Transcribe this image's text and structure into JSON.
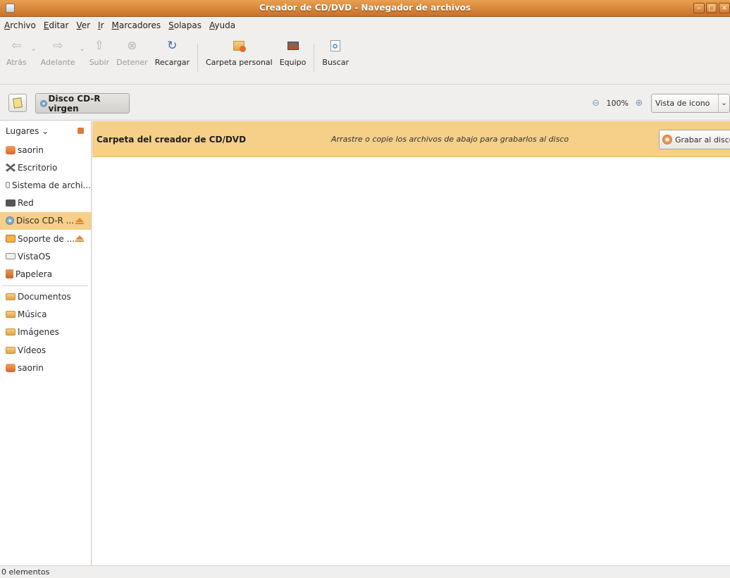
{
  "window": {
    "title": "Creador de CD/DVD - Navegador de archivos"
  },
  "menubar": {
    "items": [
      "Archivo",
      "Editar",
      "Ver",
      "Ir",
      "Marcadores",
      "Solapas",
      "Ayuda"
    ]
  },
  "toolbar": {
    "back": "Atrás",
    "forward": "Adelante",
    "up": "Subir",
    "stop": "Detener",
    "reload": "Recargar",
    "home": "Carpeta personal",
    "computer": "Equipo",
    "search": "Buscar"
  },
  "location": {
    "path_button": "Disco CD-R virgen",
    "zoom": "100%",
    "view_mode": "Vista de icono"
  },
  "sidebar": {
    "header": "Lugares",
    "places": [
      {
        "label": "saorin",
        "icon": "home-folder-icon"
      },
      {
        "label": "Escritorio",
        "icon": "desktop-icon"
      },
      {
        "label": "Sistema de archi...",
        "icon": "drive-icon"
      },
      {
        "label": "Red",
        "icon": "network-icon"
      },
      {
        "label": "Disco CD-R ...",
        "icon": "cd-icon",
        "selected": true
      },
      {
        "label": "Soporte de ...",
        "icon": "media-icon"
      },
      {
        "label": "VistaOS",
        "icon": "drive-icon"
      },
      {
        "label": "Papelera",
        "icon": "trash-icon"
      }
    ],
    "bookmarks": [
      {
        "label": "Documentos",
        "icon": "folder-icon"
      },
      {
        "label": "Música",
        "icon": "folder-icon"
      },
      {
        "label": "Imágenes",
        "icon": "folder-icon"
      },
      {
        "label": "Vídeos",
        "icon": "folder-icon"
      },
      {
        "label": "saorin",
        "icon": "home-folder-icon"
      }
    ]
  },
  "banner": {
    "title": "Carpeta del creador de CD/DVD",
    "hint": "Arrastre o copie los archivos de abajo para grabarlos al disco",
    "burn_button": "Grabar al disco"
  },
  "status": {
    "text": "0 elementos"
  },
  "colors": {
    "titlebar": "#d9843c",
    "selection": "#f6cf88"
  }
}
